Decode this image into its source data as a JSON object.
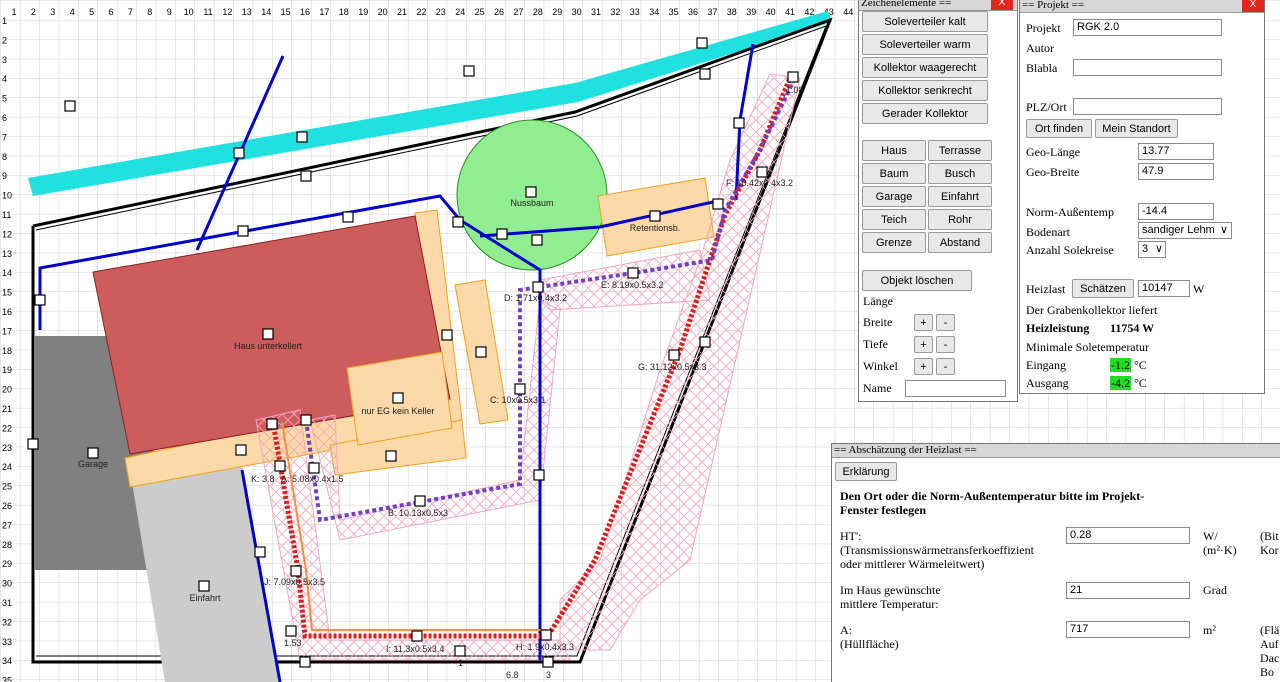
{
  "ruler": {
    "top": [
      "1",
      "2",
      "3",
      "4",
      "5",
      "6",
      "7",
      "8",
      "9",
      "10",
      "11",
      "12",
      "13",
      "14",
      "15",
      "16",
      "17",
      "18",
      "19",
      "20",
      "21",
      "22",
      "23",
      "24",
      "25",
      "26",
      "27",
      "28",
      "29",
      "30",
      "31",
      "32",
      "33",
      "34",
      "35",
      "36",
      "37",
      "38",
      "39",
      "40",
      "41",
      "42",
      "43",
      "44"
    ],
    "left": [
      "1",
      "2",
      "3",
      "4",
      "5",
      "6",
      "7",
      "8",
      "9",
      "10",
      "11",
      "12",
      "13",
      "14",
      "15",
      "16",
      "17",
      "18",
      "19",
      "20",
      "21",
      "22",
      "23",
      "24",
      "25",
      "26",
      "27",
      "28",
      "29",
      "30",
      "31",
      "32",
      "33",
      "34",
      "35"
    ]
  },
  "map": {
    "labels": {
      "haus": "Haus unterkellert",
      "eg": "nur EG kein Keller",
      "garage": "Garage",
      "einfahrt": "Einfahrt",
      "nussbaum": "Nussbaum",
      "retention": "Retentionsb.",
      "colA": "A: 5.08x0.4x1.5",
      "colB": "B: 10.13x0.5x3",
      "colC": "C: 10x0.5x3.1",
      "colD": "D: 1.71x0.4x3.2",
      "colE": "E: 8.19x0.5x3.2",
      "colF": "F: 10.42x0.4x3.2",
      "colG": "G: 31.12x0.5x3.3",
      "colH": "H: 1.9x0.4x3.3",
      "colI": "I: 11.3x0.5x3.4",
      "colJ": "J: 7.09x0.5x3.5",
      "colK": "K: 3.8",
      "d108": "1.08",
      "d153": "1.53",
      "d68": "6.8",
      "d3": "3",
      "d1": "1"
    },
    "colors": {
      "haus": "#cd5c5c",
      "terrace": "#fbd9a8",
      "garage": "#808080",
      "einfahrt": "#cccccc",
      "tree": "#90ee90",
      "hedge": "#20e0e0",
      "pipe": "#0000cc"
    }
  },
  "zeichen": {
    "title": "Zeichenelemente ==",
    "buttons": [
      "Soleverteiler kalt",
      "Soleverteiler warm",
      "Kollektor waagerecht",
      "Kollektor senkrecht",
      "Gerader Kollektor"
    ],
    "grid": [
      "Haus",
      "Terrasse",
      "Baum",
      "Busch",
      "Garage",
      "Einfahrt",
      "Teich",
      "Rohr",
      "Grenze",
      "Abstand"
    ],
    "delete": "Objekt löschen",
    "laenge": "Länge",
    "breite": "Breite",
    "tiefe": "Tiefe",
    "winkel": "Winkel",
    "name": "Name",
    "plus": "+",
    "minus": "-"
  },
  "projekt": {
    "title": "== Projekt ==",
    "close": "X",
    "projekt_label": "Projekt",
    "projekt_value": "RGK 2.0",
    "autor": "Autor",
    "blabla": "Blabla",
    "plz": "PLZ/Ort",
    "ort_finden": "Ort finden",
    "mein_standort": "Mein Standort",
    "geo_laenge": "Geo-Länge",
    "geo_laenge_val": "13.77",
    "geo_breite": "Geo-Breite",
    "geo_breite_val": "47.9",
    "norm": "Norm-Außentemp",
    "norm_val": "-14.4",
    "bodenart": "Bodenart",
    "bodenart_val": "sandiger Lehm",
    "solekreise": "Anzahl Solekreise",
    "solekreise_val": "3",
    "heizlast": "Heizlast",
    "schaetzen": "Schätzen",
    "heizlast_val": "10147",
    "unit_w": "W",
    "liefert": "Der Grabenkollektor liefert",
    "heizleistung": "Heizleistung",
    "heizleistung_val": "11754 W",
    "minimale": "Minimale Soletemperatur",
    "eingang": "Eingang",
    "eingang_val": "-1.2",
    "ausgang": "Ausgang",
    "ausgang_val": "-4.2",
    "unit_c": "°C"
  },
  "heizlast": {
    "title": "== Abschätzung der Heizlast ==",
    "erklaerung": "Erklärung",
    "hint1": "Den Ort oder die Norm-Außentemperatur bitte im Projekt-",
    "hint2": "Fenster festlegen",
    "ht_label": "HT':",
    "ht_desc1": "(Transmissionswärmetransferkoeffizient",
    "ht_desc2": "oder mittlerer Wärmeleitwert)",
    "ht_val": "0.28",
    "ht_unit1": "W/",
    "ht_unit2": "(m²·K)",
    "ht_note1": "(Bit",
    "ht_note2": "Kor",
    "temp1": "Im Haus gewünschte",
    "temp2": "mittlere Temperatur:",
    "temp_val": "21",
    "temp_unit": "Grad",
    "a_label": "A:",
    "a_desc": "(Hüllfläche)",
    "a_val": "717",
    "a_unit": "m²",
    "a_note1": "(Flä",
    "a_note2": "Auf",
    "a_note3": "Dac",
    "a_note4": "Bo"
  }
}
